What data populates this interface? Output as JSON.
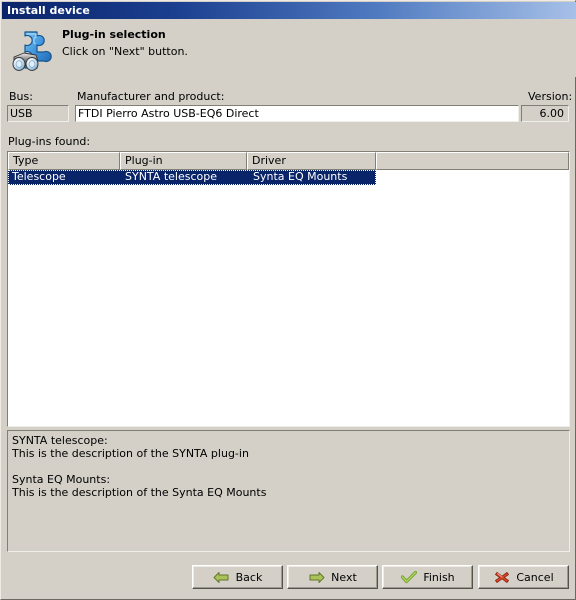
{
  "window": {
    "title": "Install device"
  },
  "header": {
    "icon": "plugin-puzzle-icon",
    "title": "Plug-in selection",
    "subtitle": "Click on \"Next\" button."
  },
  "fields": {
    "bus_label": "Bus:",
    "bus_value": "USB",
    "manufacturer_label": "Manufacturer and product:",
    "manufacturer_value": "FTDI Pierro Astro USB-EQ6 Direct",
    "version_label": "Version:",
    "version_value": "6.00"
  },
  "list": {
    "caption": "Plug-ins found:",
    "columns": [
      "Type",
      "Plug-in",
      "Driver",
      ""
    ],
    "rows": [
      {
        "type": "Telescope",
        "plugin": "SYNTA telescope",
        "driver": "Synta EQ Mounts",
        "selected": true
      }
    ]
  },
  "description": {
    "lines": [
      "SYNTA telescope:",
      "This is the description of the SYNTA plug-in",
      "",
      "Synta EQ Mounts:",
      "This is the description of the Synta EQ Mounts"
    ],
    "line1": "SYNTA telescope:",
    "line2": "This is the description of the SYNTA plug-in",
    "line3": "Synta EQ Mounts:",
    "line4": "This is the description of the Synta EQ Mounts"
  },
  "buttons": {
    "back": "Back",
    "next": "Next",
    "finish": "Finish",
    "cancel": "Cancel"
  },
  "colors": {
    "titlebar_start": "#0a246a",
    "titlebar_end": "#a6c0e8",
    "dialog_face": "#d4d0c8",
    "selection": "#0a246a",
    "arrow_green": "#8fae4a",
    "check_green": "#72a32e",
    "cancel_red": "#d44a2a"
  }
}
